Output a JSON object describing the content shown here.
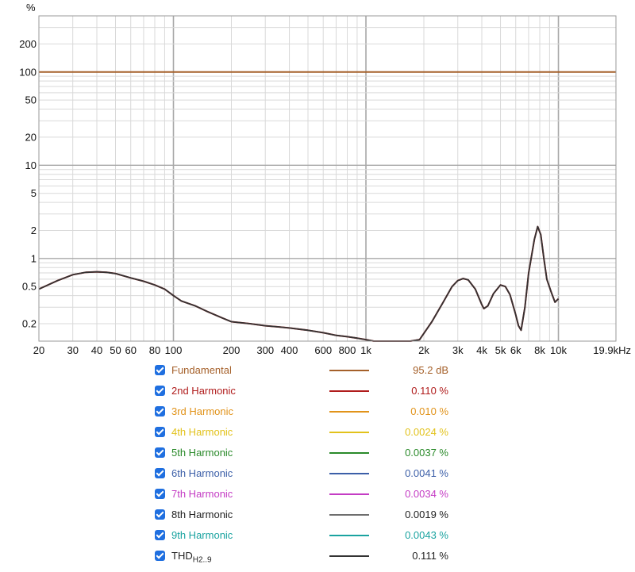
{
  "chart_data": {
    "type": "line",
    "y_unit": "%",
    "x_scale": "log",
    "y_scale": "log",
    "xlim": [
      20,
      19900
    ],
    "ylim": [
      0.13,
      400
    ],
    "x_ticks": [
      {
        "v": 20,
        "label": "20"
      },
      {
        "v": 30,
        "label": "30"
      },
      {
        "v": 40,
        "label": "40"
      },
      {
        "v": 50,
        "label": "50"
      },
      {
        "v": 60,
        "label": "60"
      },
      {
        "v": 80,
        "label": "80"
      },
      {
        "v": 100,
        "label": "100"
      },
      {
        "v": 200,
        "label": "200"
      },
      {
        "v": 300,
        "label": "300"
      },
      {
        "v": 400,
        "label": "400"
      },
      {
        "v": 600,
        "label": "600"
      },
      {
        "v": 800,
        "label": "800"
      },
      {
        "v": 1000,
        "label": "1k"
      },
      {
        "v": 2000,
        "label": "2k"
      },
      {
        "v": 3000,
        "label": "3k"
      },
      {
        "v": 4000,
        "label": "4k"
      },
      {
        "v": 5000,
        "label": "5k"
      },
      {
        "v": 6000,
        "label": "6k"
      },
      {
        "v": 8000,
        "label": "8k"
      },
      {
        "v": 10000,
        "label": "10k"
      },
      {
        "v": 19900,
        "label": "19.9kHz"
      }
    ],
    "y_ticks": [
      {
        "v": 200,
        "label": "200"
      },
      {
        "v": 100,
        "label": "100"
      },
      {
        "v": 50,
        "label": "50"
      },
      {
        "v": 20,
        "label": "20"
      },
      {
        "v": 10,
        "label": "10"
      },
      {
        "v": 5,
        "label": "5"
      },
      {
        "v": 2,
        "label": "2"
      },
      {
        "v": 1,
        "label": "1"
      },
      {
        "v": 0.5,
        "label": "0.5"
      },
      {
        "v": 0.2,
        "label": "0.2"
      }
    ],
    "grid": true,
    "legend_position": "bottom",
    "series": [
      {
        "name": "Fundamental",
        "color": "#a5602a",
        "value_label": "95.2 dB",
        "points": [
          [
            20,
            100
          ],
          [
            19900,
            100
          ]
        ]
      },
      {
        "name": "2nd Harmonic",
        "color": "#b01c1c",
        "value_label": "0.110 %",
        "points": [
          [
            20,
            0.47
          ],
          [
            25,
            0.58
          ],
          [
            30,
            0.67
          ],
          [
            35,
            0.71
          ],
          [
            40,
            0.72
          ],
          [
            45,
            0.71
          ],
          [
            50,
            0.69
          ],
          [
            60,
            0.62
          ],
          [
            70,
            0.57
          ],
          [
            80,
            0.52
          ],
          [
            90,
            0.47
          ],
          [
            100,
            0.4
          ],
          [
            110,
            0.35
          ],
          [
            130,
            0.31
          ],
          [
            150,
            0.27
          ],
          [
            180,
            0.23
          ],
          [
            200,
            0.21
          ],
          [
            250,
            0.2
          ],
          [
            300,
            0.19
          ],
          [
            350,
            0.185
          ],
          [
            400,
            0.18
          ],
          [
            500,
            0.17
          ],
          [
            600,
            0.16
          ],
          [
            700,
            0.15
          ],
          [
            800,
            0.145
          ],
          [
            900,
            0.14
          ],
          [
            1000,
            0.135
          ],
          [
            1100,
            0.128
          ],
          [
            1200,
            0.124
          ],
          [
            1700,
            0.124
          ],
          [
            1900,
            0.135
          ],
          [
            2200,
            0.21
          ],
          [
            2500,
            0.33
          ],
          [
            2800,
            0.5
          ],
          [
            3000,
            0.58
          ],
          [
            3200,
            0.61
          ],
          [
            3400,
            0.59
          ],
          [
            3700,
            0.47
          ],
          [
            4000,
            0.32
          ],
          [
            4100,
            0.29
          ],
          [
            4300,
            0.31
          ],
          [
            4600,
            0.42
          ],
          [
            5000,
            0.52
          ],
          [
            5300,
            0.5
          ],
          [
            5600,
            0.41
          ],
          [
            6000,
            0.25
          ],
          [
            6200,
            0.19
          ],
          [
            6400,
            0.17
          ],
          [
            6700,
            0.3
          ],
          [
            7000,
            0.7
          ],
          [
            7500,
            1.6
          ],
          [
            7800,
            2.2
          ],
          [
            8100,
            1.8
          ],
          [
            8400,
            1.0
          ],
          [
            8700,
            0.6
          ],
          [
            9200,
            0.43
          ],
          [
            9600,
            0.34
          ],
          [
            10000,
            0.37
          ]
        ]
      },
      {
        "name": "3rd Harmonic",
        "color": "#e1931a",
        "value_label": "0.010 %",
        "points": []
      },
      {
        "name": "4th Harmonic",
        "color": "#e2c21b",
        "value_label": "0.0024 %",
        "points": []
      },
      {
        "name": "5th Harmonic",
        "color": "#2a8a2a",
        "value_label": "0.0037 %",
        "points": []
      },
      {
        "name": "6th Harmonic",
        "color": "#3c5fa8",
        "value_label": "0.0041 %",
        "points": []
      },
      {
        "name": "7th Harmonic",
        "color": "#c43cc4",
        "value_label": "0.0034 %",
        "points": []
      },
      {
        "name": "8th Harmonic",
        "color": "#6e6e6e",
        "value_label": "0.0019 %",
        "points": []
      },
      {
        "name": "9th Harmonic",
        "color": "#1aa3a0",
        "value_label": "0.0043 %",
        "points": []
      },
      {
        "name": "THD",
        "name_sub": "H2..9",
        "color": "#333333",
        "value_label": "0.111 %",
        "points": [
          [
            20,
            0.47
          ],
          [
            25,
            0.58
          ],
          [
            30,
            0.67
          ],
          [
            35,
            0.71
          ],
          [
            40,
            0.72
          ],
          [
            45,
            0.71
          ],
          [
            50,
            0.69
          ],
          [
            60,
            0.62
          ],
          [
            70,
            0.57
          ],
          [
            80,
            0.52
          ],
          [
            90,
            0.47
          ],
          [
            100,
            0.4
          ],
          [
            110,
            0.35
          ],
          [
            130,
            0.31
          ],
          [
            150,
            0.27
          ],
          [
            180,
            0.23
          ],
          [
            200,
            0.21
          ],
          [
            250,
            0.2
          ],
          [
            300,
            0.19
          ],
          [
            350,
            0.185
          ],
          [
            400,
            0.18
          ],
          [
            500,
            0.17
          ],
          [
            600,
            0.16
          ],
          [
            700,
            0.15
          ],
          [
            800,
            0.145
          ],
          [
            900,
            0.14
          ],
          [
            1000,
            0.135
          ],
          [
            1100,
            0.128
          ],
          [
            1200,
            0.124
          ],
          [
            1700,
            0.124
          ],
          [
            1900,
            0.135
          ],
          [
            2200,
            0.21
          ],
          [
            2500,
            0.33
          ],
          [
            2800,
            0.5
          ],
          [
            3000,
            0.58
          ],
          [
            3200,
            0.61
          ],
          [
            3400,
            0.59
          ],
          [
            3700,
            0.47
          ],
          [
            4000,
            0.32
          ],
          [
            4100,
            0.29
          ],
          [
            4300,
            0.31
          ],
          [
            4600,
            0.42
          ],
          [
            5000,
            0.52
          ],
          [
            5300,
            0.5
          ],
          [
            5600,
            0.41
          ],
          [
            6000,
            0.25
          ],
          [
            6200,
            0.19
          ],
          [
            6400,
            0.17
          ],
          [
            6700,
            0.3
          ],
          [
            7000,
            0.7
          ],
          [
            7500,
            1.6
          ],
          [
            7800,
            2.2
          ],
          [
            8100,
            1.8
          ],
          [
            8400,
            1.0
          ],
          [
            8700,
            0.6
          ],
          [
            9200,
            0.43
          ],
          [
            9600,
            0.34
          ],
          [
            10000,
            0.37
          ]
        ]
      }
    ]
  },
  "ui": {
    "checkbox_color": "#1f6fe0",
    "checkbox_state": "checked"
  }
}
